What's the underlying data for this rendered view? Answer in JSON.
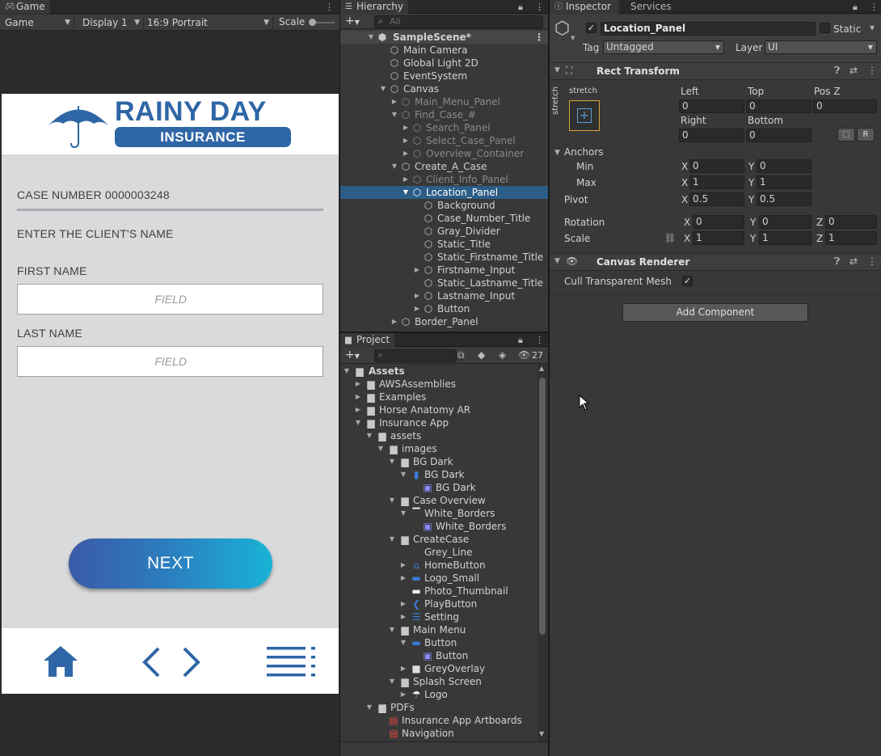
{
  "game": {
    "tab": "Game",
    "mode": "Game",
    "display": "Display 1",
    "aspect": "16:9 Portrait",
    "scale_label": "Scale",
    "app": {
      "brand_top": "RAINY DAY",
      "brand_bottom": "INSURANCE",
      "case_number": "CASE NUMBER 0000003248",
      "enter_name": "ENTER THE CLIENT'S NAME",
      "first_name": "FIRST NAME",
      "first_placeholder": "FIELD",
      "last_name": "LAST NAME",
      "last_placeholder": "FIELD",
      "next": "NEXT",
      "brand_color": "#2f66a6",
      "gradient_from": "#3b5aa6",
      "gradient_to": "#19b3d5"
    }
  },
  "hierarchy": {
    "tab": "Hierarchy",
    "search_placeholder": "All",
    "scene": "SampleScene*",
    "items": [
      {
        "label": "Main Camera"
      },
      {
        "label": "Global Light 2D"
      },
      {
        "label": "EventSystem"
      },
      {
        "label": "Canvas"
      },
      {
        "label": "Main_Menu_Panel"
      },
      {
        "label": "Find_Case_#"
      },
      {
        "label": "Search_Panel"
      },
      {
        "label": "Select_Case_Panel"
      },
      {
        "label": "Overview_Container"
      },
      {
        "label": "Create_A_Case"
      },
      {
        "label": "Client_Info_Panel"
      },
      {
        "label": "Location_Panel"
      },
      {
        "label": "Background"
      },
      {
        "label": "Case_Number_Title"
      },
      {
        "label": "Gray_Divider"
      },
      {
        "label": "Static_Title"
      },
      {
        "label": "Static_Firstname_Title"
      },
      {
        "label": "Firstname_Input"
      },
      {
        "label": "Static_Lastname_Title"
      },
      {
        "label": "Lastname_Input"
      },
      {
        "label": "Button"
      },
      {
        "label": "Border_Panel"
      }
    ]
  },
  "project": {
    "tab": "Project",
    "hidden_count": "27",
    "items": [
      {
        "label": "Assets"
      },
      {
        "label": "AWSAssemblies"
      },
      {
        "label": "Examples"
      },
      {
        "label": "Horse Anatomy AR"
      },
      {
        "label": "Insurance App"
      },
      {
        "label": "assets"
      },
      {
        "label": "images"
      },
      {
        "label": "BG Dark"
      },
      {
        "label": "BG Dark"
      },
      {
        "label": "BG Dark"
      },
      {
        "label": "Case Overview"
      },
      {
        "label": "White_Borders"
      },
      {
        "label": "White_Borders"
      },
      {
        "label": "CreateCase"
      },
      {
        "label": "Grey_Line"
      },
      {
        "label": "HomeButton"
      },
      {
        "label": "Logo_Small"
      },
      {
        "label": "Photo_Thumbnail"
      },
      {
        "label": "PlayButton"
      },
      {
        "label": "Setting"
      },
      {
        "label": "Main Menu"
      },
      {
        "label": "Button"
      },
      {
        "label": "Button"
      },
      {
        "label": "GreyOverlay"
      },
      {
        "label": "Splash Screen"
      },
      {
        "label": "Logo"
      },
      {
        "label": "PDFs"
      },
      {
        "label": "Insurance App Artboards"
      },
      {
        "label": "Navigation"
      }
    ]
  },
  "inspector": {
    "tab": "Inspector",
    "tab2": "Services",
    "object_name": "Location_Panel",
    "static_label": "Static",
    "tag_label": "Tag",
    "tag_value": "Untagged",
    "layer_label": "Layer",
    "layer_value": "UI",
    "rect_transform": {
      "title": "Rect Transform",
      "stretch_label": "stretch",
      "left_label": "Left",
      "left": "0",
      "top_label": "Top",
      "top": "0",
      "posz_label": "Pos Z",
      "posz": "0",
      "right_label": "Right",
      "right": "0",
      "bottom_label": "Bottom",
      "bottom": "0",
      "r_button": "R",
      "anchors_label": "Anchors",
      "min_label": "Min",
      "min_x": "0",
      "min_y": "0",
      "max_label": "Max",
      "max_x": "1",
      "max_y": "1",
      "pivot_label": "Pivot",
      "pivot_x": "0.5",
      "pivot_y": "0.5",
      "rotation_label": "Rotation",
      "rot_x": "0",
      "rot_y": "0",
      "rot_z": "0",
      "scale_label": "Scale",
      "scale_x": "1",
      "scale_y": "1",
      "scale_z": "1",
      "x": "X",
      "y": "Y",
      "z": "Z"
    },
    "canvas_renderer": {
      "title": "Canvas Renderer",
      "cull_label": "Cull Transparent Mesh"
    },
    "add_component": "Add Component"
  }
}
